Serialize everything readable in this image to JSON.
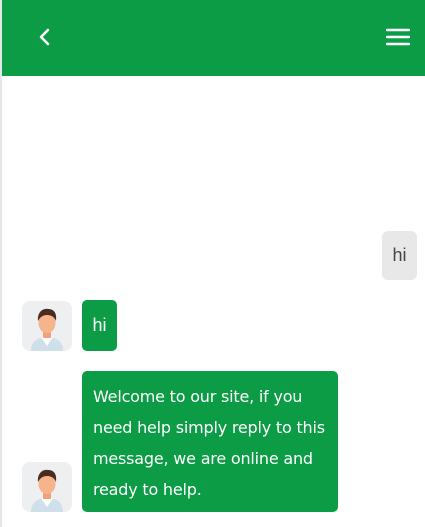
{
  "colors": {
    "brand_green": "#0c9c46",
    "user_bubble": "#e8e8e8",
    "avatar_bg": "#eeeff1"
  },
  "header": {
    "back_icon": "chevron-left-icon",
    "menu_icon": "hamburger-menu-icon"
  },
  "messages": [
    {
      "sender": "user",
      "text": "hi"
    },
    {
      "sender": "bot",
      "avatar": "agent-avatar",
      "text": "hi"
    },
    {
      "sender": "bot",
      "avatar": "agent-avatar",
      "text": "Welcome to our site, if you need help simply reply to this message, we are online and ready to help."
    }
  ]
}
